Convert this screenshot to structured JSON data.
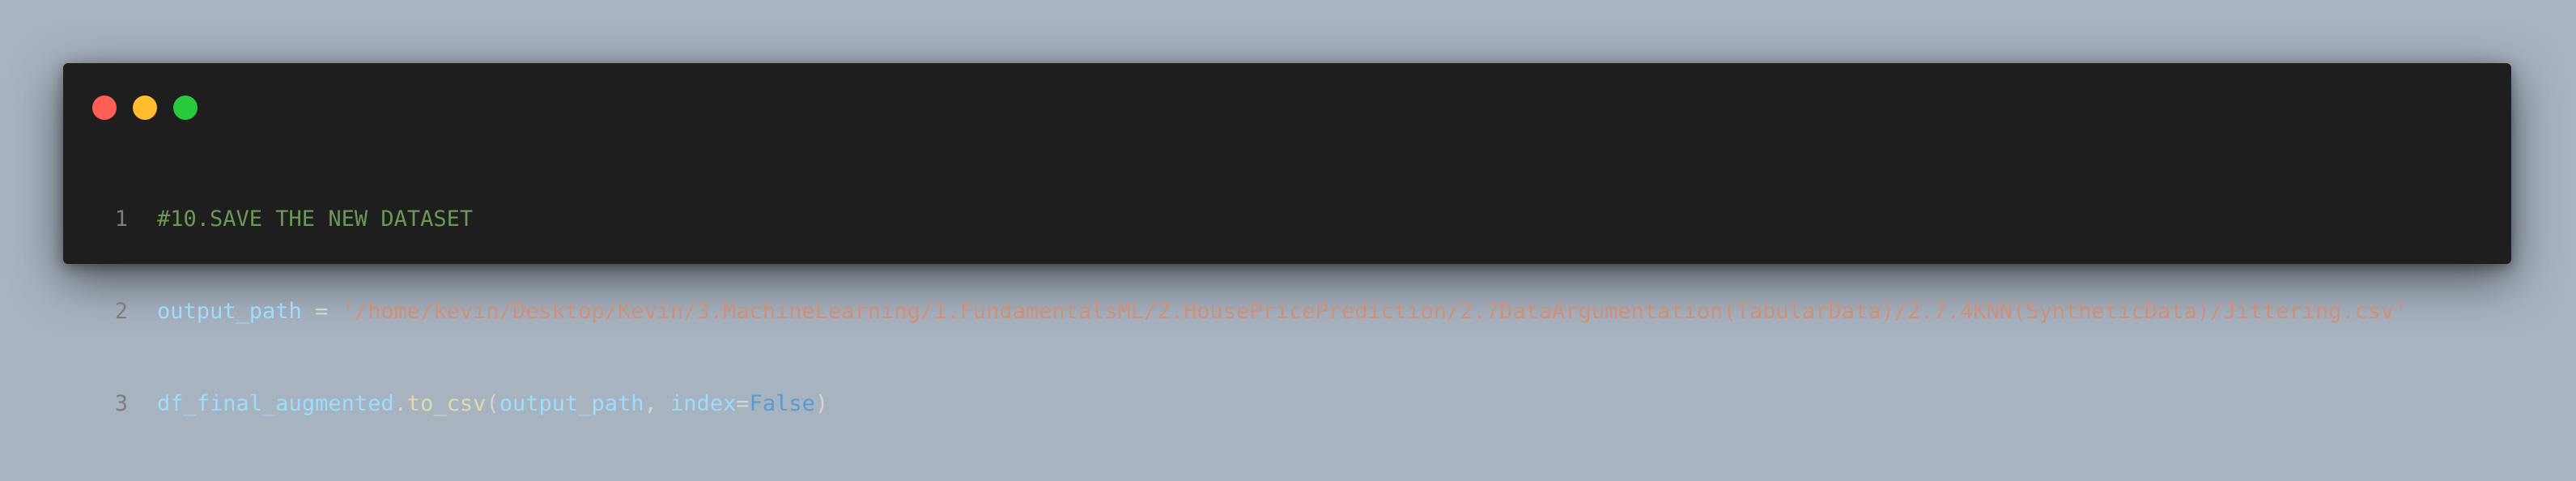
{
  "window": {
    "controls": [
      {
        "name": "close",
        "color": "#ff5f56"
      },
      {
        "name": "minimize",
        "color": "#ffbd2e"
      },
      {
        "name": "maximize",
        "color": "#27c93f"
      }
    ]
  },
  "code": {
    "lines": [
      {
        "number": "1",
        "tokens": [
          {
            "text": "#10.SAVE THE NEW DATASET",
            "kind": "comment"
          }
        ]
      },
      {
        "number": "2",
        "tokens": [
          {
            "text": "output_path",
            "kind": "var"
          },
          {
            "text": " = ",
            "kind": "op"
          },
          {
            "text": "'/home/kevin/Desktop/Kevin/3.MachineLearning/1.FundamentalsML/2.HousePricePrediction/2.7DataArgumentation(TabularData)/2.7.4KNN(SyntheticData)/Jittering.csv'",
            "kind": "str"
          }
        ]
      },
      {
        "number": "3",
        "tokens": [
          {
            "text": "df_final_augmented",
            "kind": "var"
          },
          {
            "text": ".",
            "kind": "op"
          },
          {
            "text": "to_csv",
            "kind": "fn"
          },
          {
            "text": "(",
            "kind": "op"
          },
          {
            "text": "output_path",
            "kind": "var"
          },
          {
            "text": ", ",
            "kind": "op"
          },
          {
            "text": "index",
            "kind": "var"
          },
          {
            "text": "=",
            "kind": "op"
          },
          {
            "text": "False",
            "kind": "kw"
          },
          {
            "text": ")",
            "kind": "op"
          }
        ]
      }
    ]
  },
  "colors": {
    "background": "#a8b3c0",
    "editor_bg": "#1e1e1e",
    "comment": "#6a9955",
    "variable": "#9cdcfe",
    "string": "#ce9178",
    "function": "#dcdcaa",
    "keyword": "#569cd6",
    "line_number": "#7d7d7d"
  }
}
